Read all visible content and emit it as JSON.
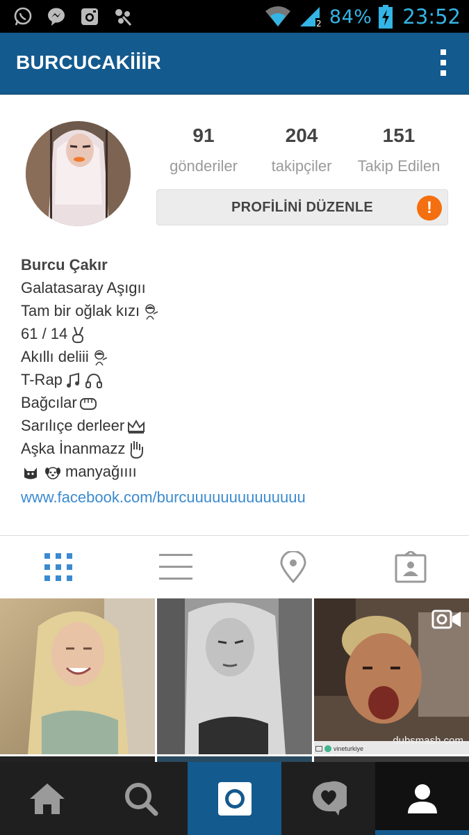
{
  "status_bar": {
    "battery": "84%",
    "clock": "23:52",
    "icons": [
      "whatsapp-icon",
      "messenger-icon",
      "instagram-icon",
      "pinwheel-icon",
      "wifi-icon",
      "signal-icon",
      "battery-charging-icon"
    ],
    "color": "#33b5e5"
  },
  "app_bar": {
    "username": "BURCUCAKİİİR",
    "menu_icon": "overflow-menu-icon",
    "color": "#135a8e"
  },
  "profile": {
    "stats": [
      {
        "value": "91",
        "label": "gönderiler"
      },
      {
        "value": "204",
        "label": "takipçiler"
      },
      {
        "value": "151",
        "label": "Takip Edilen"
      }
    ],
    "edit_button_label": "PROFİLİNİ DÜZENLE",
    "alert_mark": "!",
    "alert_color": "#f46f0f"
  },
  "bio": {
    "name": "Burcu Çakır",
    "lines": [
      "Galatasaray Aşıgıı",
      "Tam bir oğlak kızı",
      "61 / 14",
      "Akıllı deliii",
      "T-Rap",
      "Bağcılar",
      "Sarılıçe derleer",
      "Aşka İnanmazz",
      "manyağıııı"
    ],
    "link": "www.facebook.com/burcuuuuuuuuuuuuuu",
    "link_color": "#3b8ad0"
  },
  "view_tabs": [
    {
      "icon": "grid-view-icon",
      "active": true
    },
    {
      "icon": "list-view-icon",
      "active": false
    },
    {
      "icon": "location-pin-icon",
      "active": false
    },
    {
      "icon": "tagged-photos-icon",
      "active": false
    }
  ],
  "grid": {
    "tiles": [
      {
        "kind": "photo"
      },
      {
        "kind": "photo"
      },
      {
        "kind": "video",
        "icon": "video-camera-icon",
        "watermark": "dubsmash.com",
        "badge": "vineturkiye"
      }
    ]
  },
  "bottom_nav": [
    {
      "icon": "home-icon",
      "active": false
    },
    {
      "icon": "search-icon",
      "active": false
    },
    {
      "icon": "camera-icon",
      "active": false,
      "highlight": "#135a8e"
    },
    {
      "icon": "activity-heart-icon",
      "active": false
    },
    {
      "icon": "profile-icon",
      "active": true
    }
  ]
}
